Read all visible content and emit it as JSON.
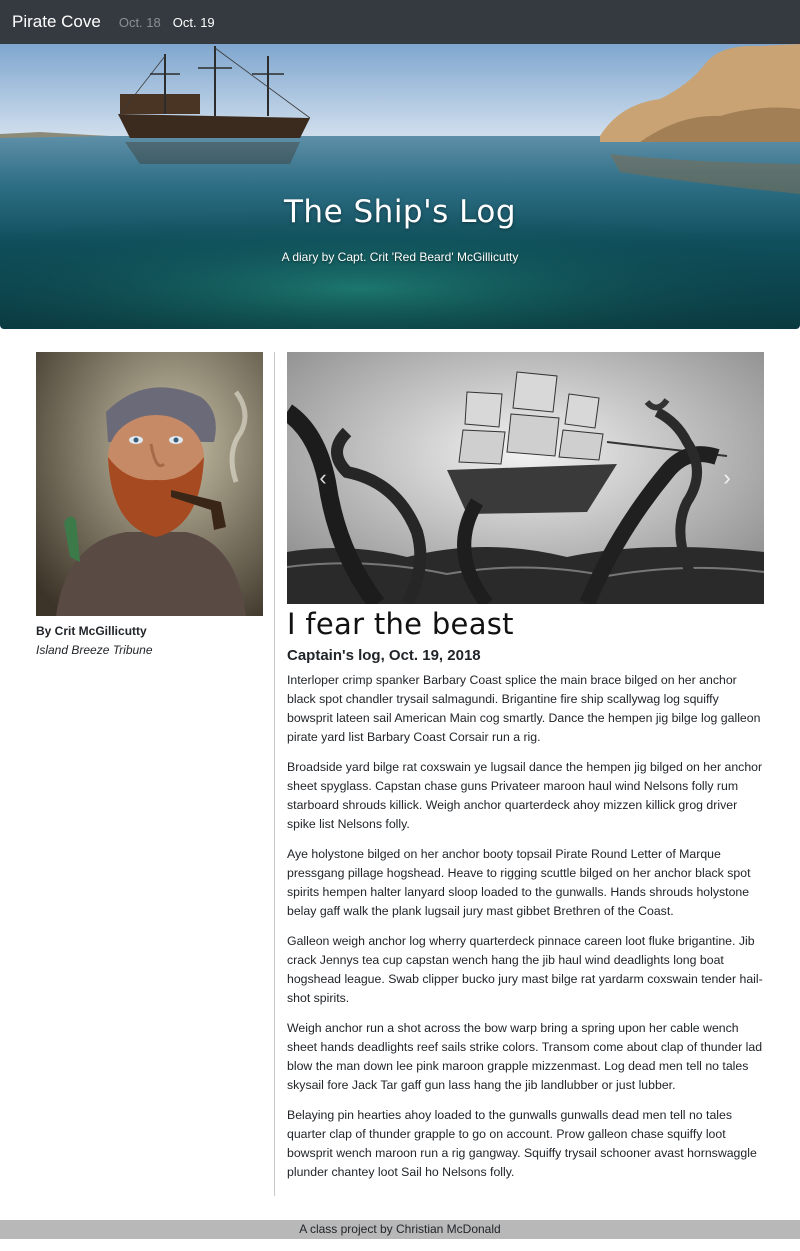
{
  "navbar": {
    "brand": "Pirate Cove",
    "links": [
      {
        "label": "Oct. 18",
        "active": false
      },
      {
        "label": "Oct. 19",
        "active": true
      }
    ]
  },
  "hero": {
    "title": "The Ship's Log",
    "subtitle": "A diary by Capt. Crit 'Red Beard' McGillicutty"
  },
  "author": {
    "byline": "By Crit McGillicutty",
    "publication": "Island Breeze Tribune"
  },
  "carousel": {
    "prev_icon": "chevron-left-icon",
    "next_icon": "chevron-right-icon"
  },
  "article": {
    "title": "I fear the beast",
    "subtitle": "Captain's log, Oct. 19, 2018",
    "paragraphs": [
      "Interloper crimp spanker Barbary Coast splice the main brace bilged on her anchor black spot chandler trysail salmagundi. Brigantine fire ship scallywag log squiffy bowsprit lateen sail American Main cog smartly. Dance the hempen jig bilge log galleon pirate yard list Barbary Coast Corsair run a rig.",
      "Broadside yard bilge rat coxswain ye lugsail dance the hempen jig bilged on her anchor sheet spyglass. Capstan chase guns Privateer maroon haul wind Nelsons folly rum starboard shrouds killick. Weigh anchor quarterdeck ahoy mizzen killick grog driver spike list Nelsons folly.",
      "Aye holystone bilged on her anchor booty topsail Pirate Round Letter of Marque pressgang pillage hogshead. Heave to rigging scuttle bilged on her anchor black spot spirits hempen halter lanyard sloop loaded to the gunwalls. Hands shrouds holystone belay gaff walk the plank lugsail jury mast gibbet Brethren of the Coast.",
      "Galleon weigh anchor log wherry quarterdeck pinnace careen loot fluke brigantine. Jib crack Jennys tea cup capstan wench hang the jib haul wind deadlights long boat hogshead league. Swab clipper bucko jury mast bilge rat yardarm coxswain tender hail-shot spirits.",
      "Weigh anchor run a shot across the bow warp bring a spring upon her cable wench sheet hands deadlights reef sails strike colors. Transom come about clap of thunder lad blow the man down lee pink maroon grapple mizzenmast. Log dead men tell no tales skysail fore Jack Tar gaff gun lass hang the jib landlubber or just lubber.",
      "Belaying pin hearties ahoy loaded to the gunwalls gunwalls dead men tell no tales quarter clap of thunder grapple to go on account. Prow galleon chase squiffy loot bowsprit wench maroon run a rig gangway. Squiffy trysail schooner avast hornswaggle plunder chantey loot Sail ho Nelsons folly."
    ]
  },
  "footer": {
    "text": "A class project by Christian McDonald"
  },
  "colors": {
    "navbar_bg": "#343a40",
    "footer_bg": "#b8b8b8",
    "text": "#212529"
  }
}
